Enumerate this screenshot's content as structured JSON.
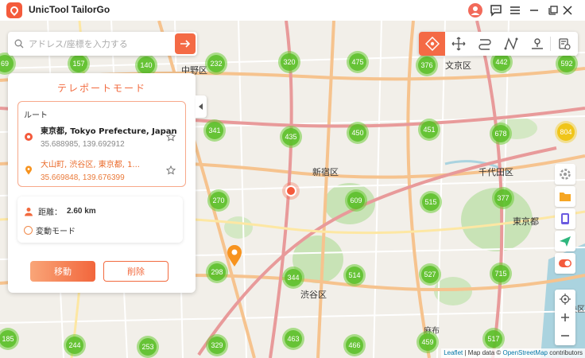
{
  "app": {
    "title": "UnicTool TailorGo"
  },
  "search": {
    "placeholder": "アドレス/座標を入力する"
  },
  "panel": {
    "title": "テレポートモード",
    "route_heading": "ルート",
    "origin": {
      "name": "東京都, Tokyo Prefecture, Japan",
      "coords": "35.688985, 139.692912"
    },
    "destination": {
      "name": "大山町, 渋谷区, 東京都, 1...",
      "coords": "35.669848, 139.676399"
    },
    "distance_label": "距離：",
    "distance_value": "2.60 km",
    "move_mode_label": "変動モード",
    "move_button": "移動",
    "delete_button": "削除"
  },
  "map_labels": [
    "中野区",
    "新宿区",
    "渋谷区",
    "千代田区",
    "東京都",
    "文京区",
    "麻布",
    "中央区"
  ],
  "clusters": {
    "c1": "157",
    "c2": "140",
    "c3": "232",
    "c4": "320",
    "c5": "475",
    "c6": "376",
    "c7": "442",
    "c8": "592",
    "c9": "69",
    "c10": "341",
    "c11": "435",
    "c12": "450",
    "c13": "451",
    "c14": "678",
    "c15": "804",
    "c16": "270",
    "c17": "609",
    "c18": "515",
    "c19": "377",
    "c20": "298",
    "c21": "344",
    "c22": "514",
    "c23": "527",
    "c24": "715",
    "c25": "185",
    "c26": "244",
    "c27": "253",
    "c28": "329",
    "c29": "463",
    "c30": "466",
    "c31": "459",
    "c32": "517"
  },
  "attribution": {
    "leaflet": "Leaflet",
    "sep": " | Map data © ",
    "osm": "OpenStreetMap",
    "tail": " contributors"
  },
  "colors": {
    "accent": "#f46a45",
    "cluster_green": "#6ecc39",
    "cluster_yellow": "#f0c20c"
  }
}
